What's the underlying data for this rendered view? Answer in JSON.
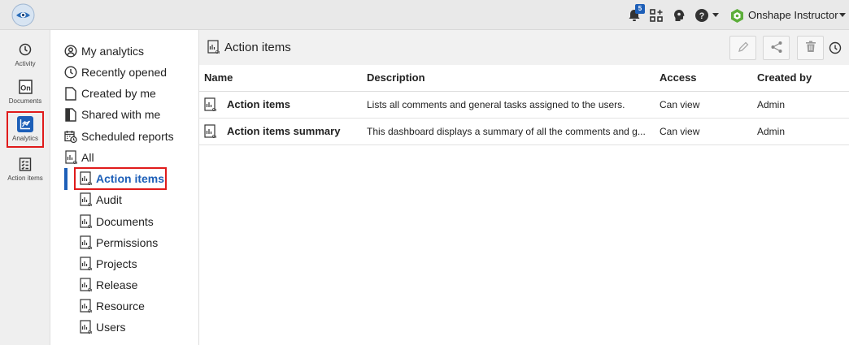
{
  "topbar": {
    "notification_count": "5",
    "user_name": "Onshape Instructor",
    "icons": [
      "onshape-logo-icon",
      "bell-icon",
      "app-store-icon",
      "learning-center-icon",
      "help-icon",
      "user-avatar-icon"
    ]
  },
  "rail": {
    "items": [
      {
        "label": "Activity",
        "icon": "clock-icon"
      },
      {
        "label": "Documents",
        "icon": "documents-icon"
      },
      {
        "label": "Analytics",
        "icon": "analytics-icon",
        "active": true
      },
      {
        "label": "Action items",
        "icon": "checklist-icon"
      }
    ]
  },
  "nav": {
    "items": [
      {
        "label": "My analytics",
        "icon": "user-circle-icon"
      },
      {
        "label": "Recently opened",
        "icon": "clock-icon"
      },
      {
        "label": "Created by me",
        "icon": "page-icon"
      },
      {
        "label": "Shared with me",
        "icon": "shared-icon"
      },
      {
        "label": "Scheduled reports",
        "icon": "calendar-icon"
      },
      {
        "label": "All",
        "icon": "report-icon"
      }
    ],
    "children": [
      {
        "label": "Action items",
        "active": true
      },
      {
        "label": "Audit"
      },
      {
        "label": "Documents"
      },
      {
        "label": "Permissions"
      },
      {
        "label": "Projects"
      },
      {
        "label": "Release"
      },
      {
        "label": "Resource"
      },
      {
        "label": "Users"
      }
    ]
  },
  "main": {
    "title": "Action items",
    "actions": [
      "pencil-icon",
      "share-icon",
      "trash-icon",
      "history-icon"
    ],
    "columns": [
      "Name",
      "Description",
      "Access",
      "Created by"
    ],
    "rows": [
      {
        "name": "Action items",
        "description": "Lists all comments and general tasks assigned to the users.",
        "access": "Can view",
        "created_by": "Admin"
      },
      {
        "name": "Action items summary",
        "description": "This dashboard displays a summary of all the comments and g...",
        "access": "Can view",
        "created_by": "Admin"
      }
    ]
  },
  "colors": {
    "accent": "#1d5fb8",
    "highlight": "#e01b1b",
    "topbar_bg": "#e9e9e9"
  }
}
